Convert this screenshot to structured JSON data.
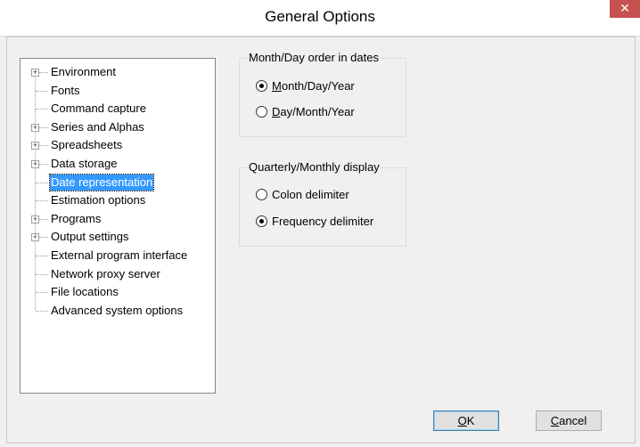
{
  "window": {
    "title": "General Options",
    "close_glyph": "✕"
  },
  "tree": {
    "items": [
      {
        "label": "Environment",
        "expandable": true
      },
      {
        "label": "Fonts",
        "expandable": false
      },
      {
        "label": "Command capture",
        "expandable": false
      },
      {
        "label": "Series and Alphas",
        "expandable": true
      },
      {
        "label": "Spreadsheets",
        "expandable": true
      },
      {
        "label": "Data storage",
        "expandable": true
      },
      {
        "label": "Date representation",
        "expandable": false,
        "selected": true
      },
      {
        "label": "Estimation options",
        "expandable": false
      },
      {
        "label": "Programs",
        "expandable": true
      },
      {
        "label": "Output settings",
        "expandable": true
      },
      {
        "label": "External program interface",
        "expandable": false
      },
      {
        "label": "Network proxy server",
        "expandable": false
      },
      {
        "label": "File locations",
        "expandable": false
      },
      {
        "label": "Advanced system options",
        "expandable": false
      }
    ]
  },
  "date_order": {
    "title": "Month/Day order in dates",
    "options": [
      {
        "label": "Month/Day/Year",
        "checked": true,
        "mnemonic": "M"
      },
      {
        "label": "Day/Month/Year",
        "checked": false,
        "mnemonic": "D"
      }
    ]
  },
  "display": {
    "title": "Quarterly/Monthly display",
    "options": [
      {
        "label": "Colon delimiter",
        "checked": false
      },
      {
        "label": "Frequency delimiter",
        "checked": true
      }
    ]
  },
  "buttons": {
    "ok": {
      "label": "OK",
      "mnemonic": "O"
    },
    "cancel": {
      "label": "Cancel",
      "mnemonic": "C"
    }
  },
  "colors": {
    "selection": "#3399ff",
    "close": "#c75050"
  }
}
